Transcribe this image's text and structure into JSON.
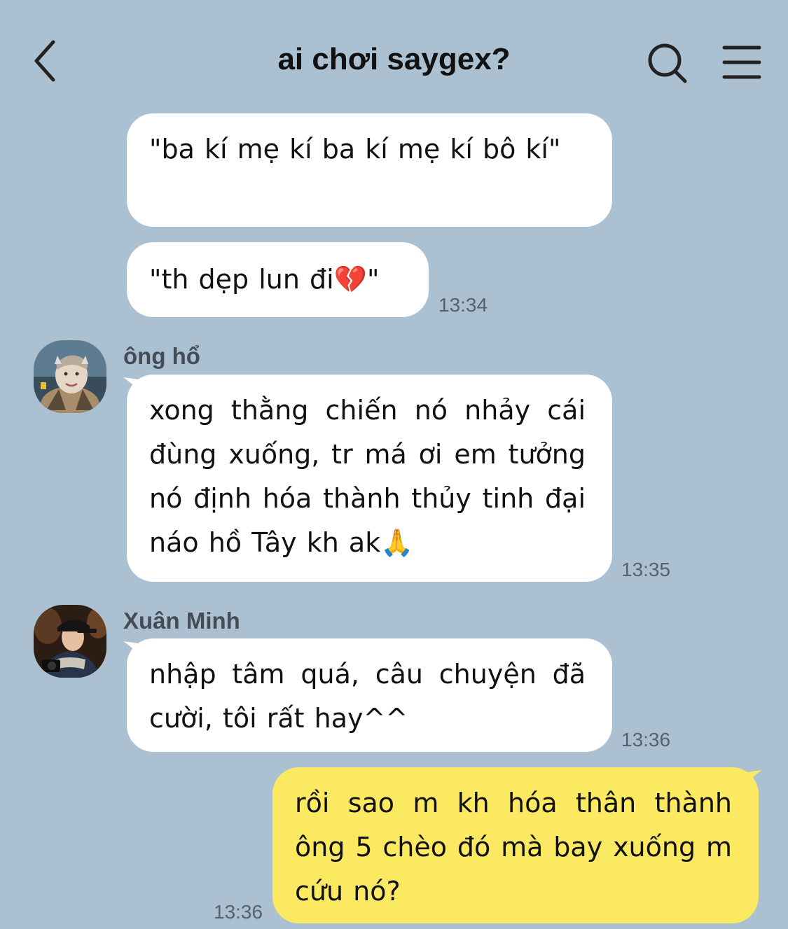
{
  "header": {
    "title": "ai chơi saygex?"
  },
  "messages": [
    {
      "text": "\"ba kí mẹ kí ba kí mẹ kí bô kí\""
    },
    {
      "text": "\"th dẹp lun đi💔\"",
      "time": "13:34"
    },
    {
      "sender": "ông hổ",
      "text": "xong thằng chiến nó nhảy cái đùng xuống, tr má ơi em tưởng nó định hóa thành thủy tinh đại náo hồ Tây kh ak🙏",
      "time": "13:35"
    },
    {
      "sender": "Xuân Minh",
      "text": "nhập tâm quá, câu chuyện đã cười, tôi rất hay^^",
      "time": "13:36"
    },
    {
      "text": "rồi sao m kh hóa thân thành ông 5 chèo đó mà bay xuống m cứu nó?",
      "time": "13:36"
    }
  ],
  "colors": {
    "background": "#abc1d1",
    "incoming_bubble": "#ffffff",
    "outgoing_bubble": "#fbe961"
  },
  "icons": [
    "back-arrow-icon",
    "search-icon",
    "menu-icon"
  ]
}
